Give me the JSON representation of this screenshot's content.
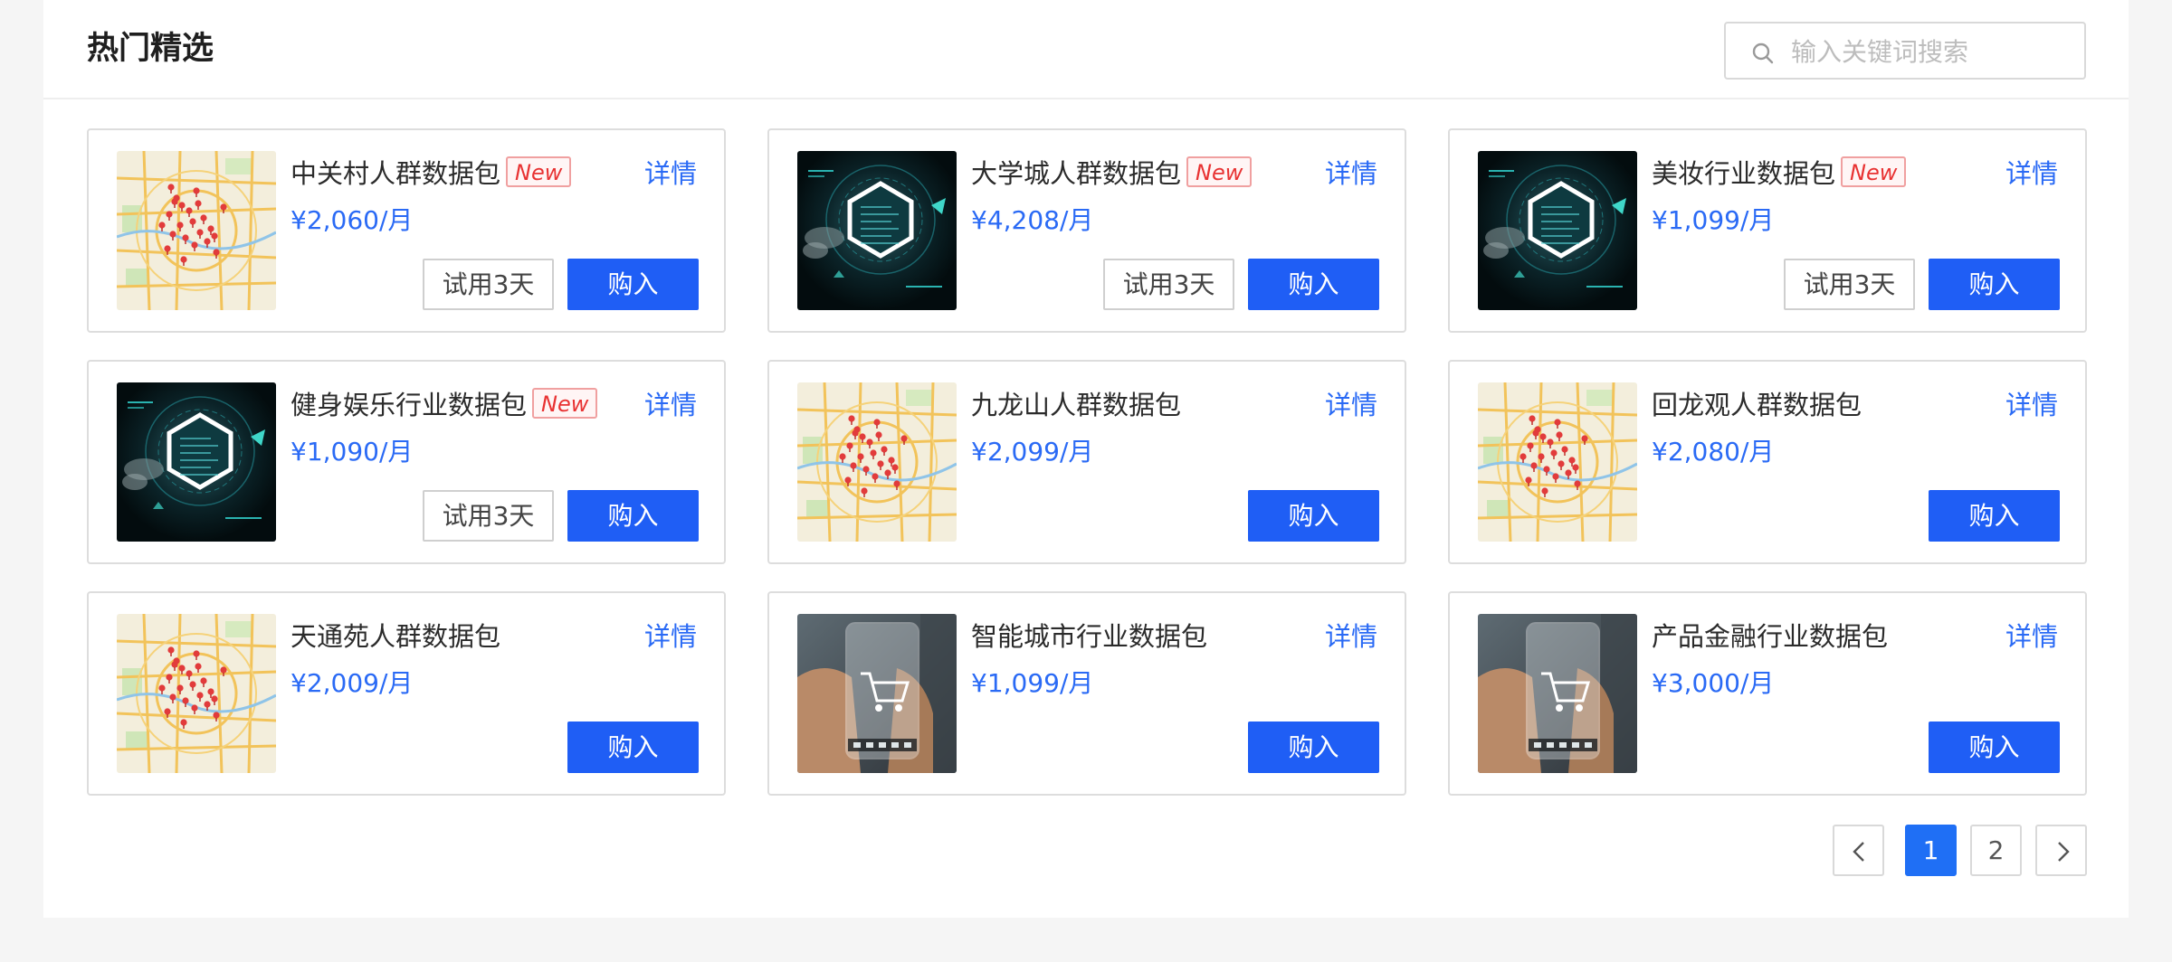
{
  "header": {
    "title": "热门精选",
    "search_placeholder": "输入关键词搜索",
    "search_value": "",
    "search_icon": "search-icon"
  },
  "products": [
    {
      "name": "中关村人群数据包",
      "badge": "New",
      "price": "¥2,060/月",
      "detail": "详情",
      "trial": "试用3天",
      "buy": "购入",
      "image": "map"
    },
    {
      "name": "大学城人群数据包",
      "badge": "New",
      "price": "¥4,208/月",
      "detail": "详情",
      "trial": "试用3天",
      "buy": "购入",
      "image": "tech"
    },
    {
      "name": "美妆行业数据包",
      "badge": "New",
      "price": "¥1,099/月",
      "detail": "详情",
      "trial": "试用3天",
      "buy": "购入",
      "image": "tech"
    },
    {
      "name": "健身娱乐行业数据包",
      "badge": "New",
      "price": "¥1,090/月",
      "detail": "详情",
      "trial": "试用3天",
      "buy": "购入",
      "image": "tech"
    },
    {
      "name": "九龙山人群数据包",
      "badge": "",
      "price": "¥2,099/月",
      "detail": "详情",
      "trial": "",
      "buy": "购入",
      "image": "map"
    },
    {
      "name": "回龙观人群数据包",
      "badge": "",
      "price": "¥2,080/月",
      "detail": "详情",
      "trial": "",
      "buy": "购入",
      "image": "map"
    },
    {
      "name": "天通苑人群数据包",
      "badge": "",
      "price": "¥2,009/月",
      "detail": "详情",
      "trial": "",
      "buy": "购入",
      "image": "map"
    },
    {
      "name": "智能城市行业数据包",
      "badge": "",
      "price": "¥1,099/月",
      "detail": "详情",
      "trial": "",
      "buy": "购入",
      "image": "phone"
    },
    {
      "name": "产品金融行业数据包",
      "badge": "",
      "price": "¥3,000/月",
      "detail": "详情",
      "trial": "",
      "buy": "购入",
      "image": "phone"
    }
  ],
  "pagination": {
    "prev_icon": "chevron-left-icon",
    "pages": [
      "1",
      "2"
    ],
    "current": "1",
    "next_icon": "chevron-right-icon"
  },
  "colors": {
    "accent": "#1f5ef5",
    "price": "#2a6af5",
    "badge": "#e83232",
    "background": "#f5f5f5"
  }
}
